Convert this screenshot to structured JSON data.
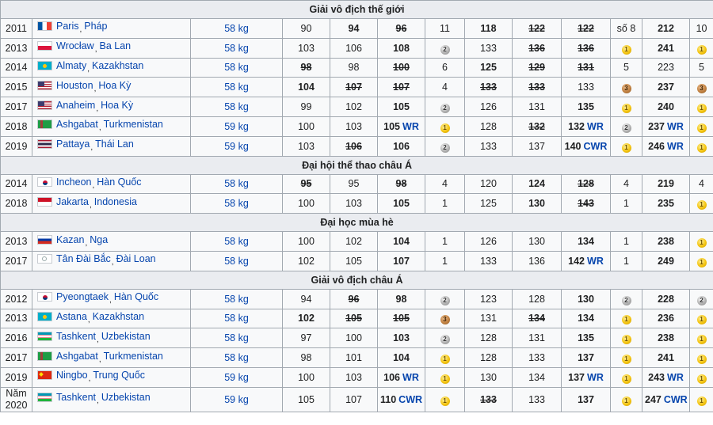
{
  "sections": [
    {
      "title": "Giải vô địch thế giới",
      "rows": [
        {
          "year": "2011",
          "flag": "fra",
          "city": "Paris",
          "country": "Pháp",
          "cls": "58 kg",
          "c": [
            {
              "t": "90"
            },
            {
              "t": "94",
              "b": true
            },
            {
              "t": "96",
              "b": true,
              "s": true
            },
            {
              "t": "11"
            },
            {
              "t": "118",
              "b": true
            },
            {
              "t": "122",
              "b": true,
              "s": true
            },
            {
              "t": "122",
              "b": true,
              "s": true
            },
            {
              "t": "số 8"
            },
            {
              "t": "212",
              "b": true
            },
            {
              "t": "10"
            }
          ]
        },
        {
          "year": "2013",
          "flag": "pol",
          "city": "Wrocław",
          "country": "Ba Lan",
          "cls": "58 kg",
          "c": [
            {
              "t": "103"
            },
            {
              "t": "106"
            },
            {
              "t": "108",
              "b": true
            },
            {
              "m": "2"
            },
            {
              "t": "133"
            },
            {
              "t": "136",
              "b": true,
              "s": true
            },
            {
              "t": "136",
              "b": true,
              "s": true
            },
            {
              "m": "1"
            },
            {
              "t": "241",
              "b": true
            },
            {
              "m": "1"
            }
          ]
        },
        {
          "year": "2014",
          "flag": "kaz",
          "city": "Almaty",
          "country": "Kazakhstan",
          "cls": "58 kg",
          "c": [
            {
              "t": "98",
              "b": true,
              "s": true
            },
            {
              "t": "98"
            },
            {
              "t": "100",
              "b": true,
              "s": true
            },
            {
              "t": "6"
            },
            {
              "t": "125",
              "b": true
            },
            {
              "t": "129",
              "b": true,
              "s": true
            },
            {
              "t": "131",
              "b": true,
              "s": true
            },
            {
              "t": "5"
            },
            {
              "t": "223"
            },
            {
              "t": "5"
            }
          ]
        },
        {
          "year": "2015",
          "flag": "usa",
          "city": "Houston",
          "country": "Hoa Kỳ",
          "cls": "58 kg",
          "c": [
            {
              "t": "104",
              "b": true
            },
            {
              "t": "107",
              "b": true,
              "s": true
            },
            {
              "t": "107",
              "b": true,
              "s": true
            },
            {
              "t": "4"
            },
            {
              "t": "133",
              "b": true,
              "s": true
            },
            {
              "t": "133",
              "b": true,
              "s": true
            },
            {
              "t": "133"
            },
            {
              "m": "3"
            },
            {
              "t": "237",
              "b": true
            },
            {
              "m": "3"
            }
          ]
        },
        {
          "year": "2017",
          "flag": "usa",
          "city": "Anaheim",
          "country": "Hoa Kỳ",
          "cls": "58 kg",
          "c": [
            {
              "t": "99"
            },
            {
              "t": "102"
            },
            {
              "t": "105",
              "b": true
            },
            {
              "m": "2"
            },
            {
              "t": "126"
            },
            {
              "t": "131"
            },
            {
              "t": "135",
              "b": true
            },
            {
              "m": "1"
            },
            {
              "t": "240",
              "b": true
            },
            {
              "m": "1"
            }
          ]
        },
        {
          "year": "2018",
          "flag": "tkm",
          "city": "Ashgabat",
          "country": "Turkmenistan",
          "cls": "59 kg",
          "c": [
            {
              "t": "100"
            },
            {
              "t": "103"
            },
            {
              "t": "105",
              "b": true,
              "r": "WR"
            },
            {
              "m": "1"
            },
            {
              "t": "128"
            },
            {
              "t": "132",
              "b": true,
              "s": true
            },
            {
              "t": "132",
              "b": true,
              "r": "WR"
            },
            {
              "m": "2"
            },
            {
              "t": "237",
              "b": true,
              "r": "WR"
            },
            {
              "m": "1"
            }
          ]
        },
        {
          "year": "2019",
          "flag": "tha",
          "city": "Pattaya",
          "country": "Thái Lan",
          "cls": "59 kg",
          "c": [
            {
              "t": "103"
            },
            {
              "t": "106",
              "b": true,
              "s": true
            },
            {
              "t": "106",
              "b": true
            },
            {
              "m": "2"
            },
            {
              "t": "133"
            },
            {
              "t": "137"
            },
            {
              "t": "140",
              "b": true,
              "r": "CWR"
            },
            {
              "m": "1"
            },
            {
              "t": "246",
              "b": true,
              "r": "WR"
            },
            {
              "m": "1"
            }
          ]
        }
      ]
    },
    {
      "title": "Đại hội thể thao châu Á",
      "rows": [
        {
          "year": "2014",
          "flag": "kor",
          "city": "Incheon",
          "country": "Hàn Quốc",
          "cls": "58 kg",
          "c": [
            {
              "t": "95",
              "b": true,
              "s": true
            },
            {
              "t": "95"
            },
            {
              "t": "98",
              "b": true,
              "s": true
            },
            {
              "t": "4"
            },
            {
              "t": "120"
            },
            {
              "t": "124",
              "b": true
            },
            {
              "t": "128",
              "b": true,
              "s": true
            },
            {
              "t": "4"
            },
            {
              "t": "219",
              "b": true
            },
            {
              "t": "4"
            }
          ]
        },
        {
          "year": "2018",
          "flag": "idn",
          "city": "Jakarta",
          "country": "Indonesia",
          "cls": "58 kg",
          "c": [
            {
              "t": "100"
            },
            {
              "t": "103"
            },
            {
              "t": "105",
              "b": true
            },
            {
              "t": "1"
            },
            {
              "t": "125"
            },
            {
              "t": "130",
              "b": true
            },
            {
              "t": "143",
              "b": true,
              "s": true
            },
            {
              "t": "1"
            },
            {
              "t": "235",
              "b": true
            },
            {
              "m": "1"
            }
          ]
        }
      ]
    },
    {
      "title": "Đại học mùa hè",
      "rows": [
        {
          "year": "2013",
          "flag": "rus",
          "city": "Kazan",
          "country": "Nga",
          "cls": "58 kg",
          "c": [
            {
              "t": "100"
            },
            {
              "t": "102"
            },
            {
              "t": "104",
              "b": true
            },
            {
              "t": "1"
            },
            {
              "t": "126"
            },
            {
              "t": "130"
            },
            {
              "t": "134",
              "b": true
            },
            {
              "t": "1"
            },
            {
              "t": "238",
              "b": true
            },
            {
              "m": "1"
            }
          ]
        },
        {
          "year": "2017",
          "flag": "tpe",
          "city": "Tân Đài Bắc",
          "country": "Đài Loan",
          "cls": "58 kg",
          "c": [
            {
              "t": "102"
            },
            {
              "t": "105"
            },
            {
              "t": "107",
              "b": true
            },
            {
              "t": "1"
            },
            {
              "t": "133"
            },
            {
              "t": "136"
            },
            {
              "t": "142",
              "b": true,
              "r": "WR"
            },
            {
              "t": "1"
            },
            {
              "t": "249",
              "b": true
            },
            {
              "m": "1"
            }
          ]
        }
      ]
    },
    {
      "title": "Giải vô địch châu Á",
      "rows": [
        {
          "year": "2012",
          "flag": "kor",
          "city": "Pyeongtaek",
          "country": "Hàn Quốc",
          "cls": "58 kg",
          "c": [
            {
              "t": "94"
            },
            {
              "t": "96",
              "b": true,
              "s": true
            },
            {
              "t": "98",
              "b": true
            },
            {
              "m": "2"
            },
            {
              "t": "123"
            },
            {
              "t": "128"
            },
            {
              "t": "130",
              "b": true
            },
            {
              "m": "2"
            },
            {
              "t": "228",
              "b": true
            },
            {
              "m": "2"
            }
          ]
        },
        {
          "year": "2013",
          "flag": "kaz",
          "city": "Astana",
          "country": "Kazakhstan",
          "cls": "58 kg",
          "c": [
            {
              "t": "102",
              "b": true
            },
            {
              "t": "105",
              "b": true,
              "s": true
            },
            {
              "t": "105",
              "b": true,
              "s": true
            },
            {
              "m": "3"
            },
            {
              "t": "131"
            },
            {
              "t": "134",
              "b": true,
              "s": true
            },
            {
              "t": "134",
              "b": true
            },
            {
              "m": "1"
            },
            {
              "t": "236",
              "b": true
            },
            {
              "m": "1"
            }
          ]
        },
        {
          "year": "2016",
          "flag": "uzb",
          "city": "Tashkent",
          "country": "Uzbekistan",
          "cls": "58 kg",
          "c": [
            {
              "t": "97"
            },
            {
              "t": "100"
            },
            {
              "t": "103",
              "b": true
            },
            {
              "m": "2"
            },
            {
              "t": "128"
            },
            {
              "t": "131"
            },
            {
              "t": "135",
              "b": true
            },
            {
              "m": "1"
            },
            {
              "t": "238",
              "b": true
            },
            {
              "m": "1"
            }
          ]
        },
        {
          "year": "2017",
          "flag": "tkm",
          "city": "Ashgabat",
          "country": "Turkmenistan",
          "cls": "58 kg",
          "c": [
            {
              "t": "98"
            },
            {
              "t": "101"
            },
            {
              "t": "104",
              "b": true
            },
            {
              "m": "1"
            },
            {
              "t": "128"
            },
            {
              "t": "133"
            },
            {
              "t": "137",
              "b": true
            },
            {
              "m": "1"
            },
            {
              "t": "241",
              "b": true
            },
            {
              "m": "1"
            }
          ]
        },
        {
          "year": "2019",
          "flag": "chn",
          "city": "Ningbo",
          "country": "Trung Quốc",
          "cls": "59 kg",
          "c": [
            {
              "t": "100"
            },
            {
              "t": "103"
            },
            {
              "t": "106",
              "b": true,
              "r": "WR"
            },
            {
              "m": "1"
            },
            {
              "t": "130"
            },
            {
              "t": "134"
            },
            {
              "t": "137",
              "b": true,
              "r": "WR"
            },
            {
              "m": "1"
            },
            {
              "t": "243",
              "b": true,
              "r": "WR"
            },
            {
              "m": "1"
            }
          ]
        },
        {
          "year": "Năm 2020",
          "flag": "uzb",
          "city": "Tashkent",
          "country": "Uzbekistan",
          "cls": "59 kg",
          "c": [
            {
              "t": "105"
            },
            {
              "t": "107"
            },
            {
              "t": "110",
              "b": true,
              "r": "CWR"
            },
            {
              "m": "1"
            },
            {
              "t": "133",
              "b": true,
              "s": true
            },
            {
              "t": "133"
            },
            {
              "t": "137",
              "b": true
            },
            {
              "m": "1"
            },
            {
              "t": "247",
              "b": true,
              "r": "CWR"
            },
            {
              "m": "1"
            }
          ]
        }
      ]
    }
  ]
}
